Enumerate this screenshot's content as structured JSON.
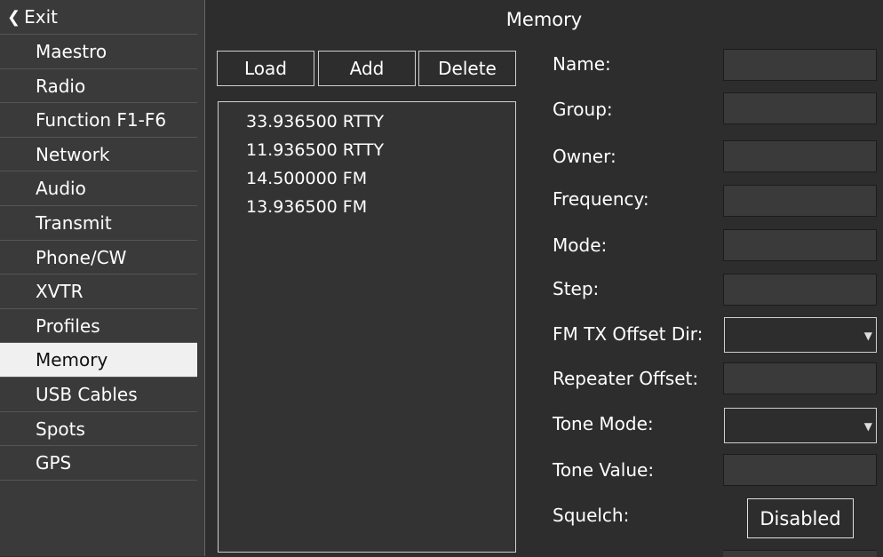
{
  "sidebar": {
    "exit_label": "Exit",
    "items": [
      {
        "label": "Maestro"
      },
      {
        "label": "Radio"
      },
      {
        "label": "Function F1-F6"
      },
      {
        "label": "Network"
      },
      {
        "label": "Audio"
      },
      {
        "label": "Transmit"
      },
      {
        "label": "Phone/CW"
      },
      {
        "label": "XVTR"
      },
      {
        "label": "Profiles"
      },
      {
        "label": "Memory"
      },
      {
        "label": "USB Cables"
      },
      {
        "label": "Spots"
      },
      {
        "label": "GPS"
      }
    ],
    "selected": "Memory"
  },
  "panel": {
    "title": "Memory",
    "buttons": {
      "load": "Load",
      "add": "Add",
      "delete": "Delete"
    },
    "memories": [
      "33.936500 RTTY",
      "11.936500 RTTY",
      "14.500000 FM",
      "13.936500 FM"
    ],
    "form": {
      "name_label": "Name:",
      "group_label": "Group:",
      "owner_label": "Owner:",
      "frequency_label": "Frequency:",
      "mode_label": "Mode:",
      "step_label": "Step:",
      "fm_tx_offset_dir_label": "FM TX Offset Dir:",
      "repeater_offset_label": "Repeater Offset:",
      "tone_mode_label": "Tone Mode:",
      "tone_value_label": "Tone Value:",
      "squelch_label": "Squelch:",
      "squelch_value": "Disabled"
    }
  },
  "colors": {
    "background": "#2d2d2d",
    "sidebar": "#3a3a3a",
    "selected_item": "#f0f0f0",
    "text": "#ffffff"
  }
}
